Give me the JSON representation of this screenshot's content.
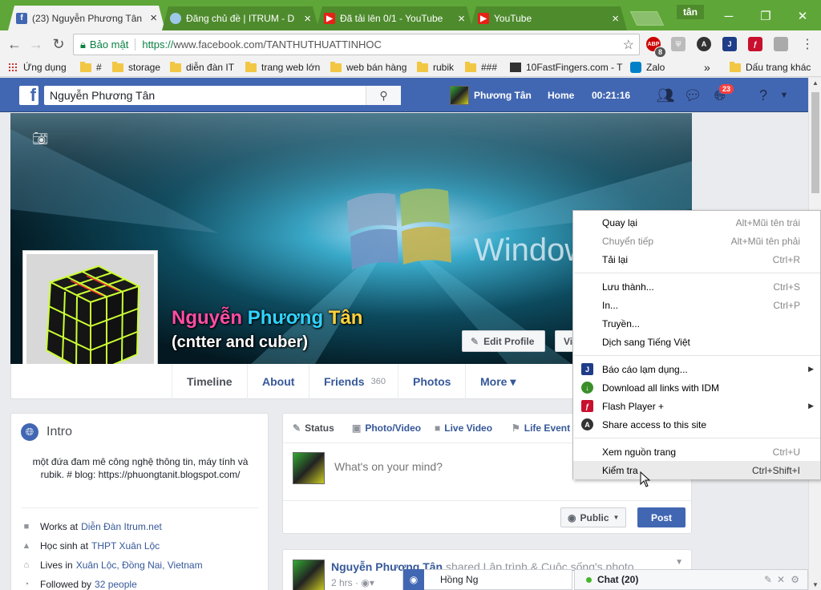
{
  "browser": {
    "tabs": [
      {
        "title": "(23) Nguyễn Phương Tân",
        "icon": "facebook-icon",
        "active": true
      },
      {
        "title": "Đăng chủ đề | ITRUM - D",
        "icon": "cloud-icon",
        "active": false
      },
      {
        "title": "Đã tải lên 0/1 - YouTube",
        "icon": "youtube-icon",
        "active": false
      },
      {
        "title": "YouTube",
        "icon": "youtube-icon",
        "active": false
      }
    ],
    "profile_name": "tân",
    "security_label": "Bảo mật",
    "url_scheme": "https://",
    "url_rest": "www.facebook.com/TANTHUTHUATTINHOC",
    "ext_badge": "8",
    "bookmarks": [
      {
        "label": "Ứng dụng",
        "icon": "apps-grid-icon"
      },
      {
        "label": "#",
        "icon": "folder-icon"
      },
      {
        "label": "storage",
        "icon": "folder-icon"
      },
      {
        "label": "diễn đàn IT",
        "icon": "folder-icon"
      },
      {
        "label": "trang web lớn",
        "icon": "folder-icon"
      },
      {
        "label": "web bán hàng",
        "icon": "folder-icon"
      },
      {
        "label": "rubik",
        "icon": "folder-icon"
      },
      {
        "label": "###",
        "icon": "folder-icon"
      },
      {
        "label": "10FastFingers.com - T",
        "icon": "keyboard-icon"
      },
      {
        "label": "Zalo",
        "icon": "zalo-icon"
      },
      {
        "label": "Dấu trang khác",
        "icon": "folder-icon"
      }
    ],
    "bookmarks_more": "»"
  },
  "fb": {
    "search_value": "Nguyễn Phương Tân",
    "nav_user": "Phương Tân",
    "nav_home": "Home",
    "nav_time": "00:21:16",
    "notif_count": "23"
  },
  "profile": {
    "name_parts": [
      "Nguyễn ",
      "Phương ",
      "Tân"
    ],
    "name_colors": [
      "#ff4da6",
      "#2fd4ff",
      "#ffd23c"
    ],
    "subtitle": "(cntter and cuber)",
    "edit_profile": "Edit Profile",
    "view_btn": "Vi",
    "cover_text": "Window",
    "tabs": [
      {
        "label": "Timeline",
        "active": true
      },
      {
        "label": "About",
        "active": false
      },
      {
        "label": "Friends",
        "count": "360",
        "active": false
      },
      {
        "label": "Photos",
        "active": false
      },
      {
        "label": "More ▾",
        "active": false
      }
    ]
  },
  "intro": {
    "title": "Intro",
    "bio": "một đứa đam mê công nghệ thông tin, máy tính và rubik. # blog: https://phuongtanit.blogspot.com/",
    "rows": [
      {
        "prefix": "Works at",
        "link": "Diễn Đàn Itrum.net",
        "icon": "briefcase-icon"
      },
      {
        "prefix": "Học sinh at",
        "link": "THPT Xuân Lộc",
        "icon": "school-icon"
      },
      {
        "prefix": "Lives in",
        "link": "Xuân Lộc, Đồng Nai, Vietnam",
        "icon": "home-icon"
      },
      {
        "prefix": "Followed by",
        "link": "32 people",
        "icon": "rss-icon"
      }
    ]
  },
  "composer": {
    "tabs": [
      {
        "label": "Status",
        "icon": "pencil-icon"
      },
      {
        "label": "Photo/Video",
        "icon": "camera-icon"
      },
      {
        "label": "Live Video",
        "icon": "video-icon"
      },
      {
        "label": "Life Event",
        "icon": "flag-icon"
      }
    ],
    "placeholder": "What's on your mind?",
    "audience": "Public",
    "post": "Post"
  },
  "story": {
    "author": "Nguyễn Phương Tân",
    "action": "shared Lập trình & Cuộc sống's photo.",
    "time": "2 hrs"
  },
  "context_menu": {
    "items": [
      {
        "label": "Quay lại",
        "shortcut": "Alt+Mũi tên trái",
        "disabled": false
      },
      {
        "label": "Chuyển tiếp",
        "shortcut": "Alt+Mũi tên phải",
        "disabled": true
      },
      {
        "label": "Tải lại",
        "shortcut": "Ctrl+R",
        "disabled": false
      },
      {
        "label": "Lưu thành...",
        "shortcut": "Ctrl+S",
        "disabled": false
      },
      {
        "label": "In...",
        "shortcut": "Ctrl+P",
        "disabled": false
      },
      {
        "label": "Truyền...",
        "shortcut": "",
        "disabled": false
      },
      {
        "label": "Dịch sang Tiếng Việt",
        "shortcut": "",
        "disabled": false
      },
      {
        "label": "Báo cáo lạm dụng...",
        "shortcut": "",
        "icon": "j-extension-icon",
        "submenu": true
      },
      {
        "label": "Download all links with IDM",
        "shortcut": "",
        "icon": "idm-icon"
      },
      {
        "label": "Flash Player +",
        "shortcut": "",
        "icon": "flash-icon",
        "submenu": true
      },
      {
        "label": "Share access to this site",
        "shortcut": "",
        "icon": "share-a-icon"
      },
      {
        "label": "Xem nguồn trang",
        "shortcut": "Ctrl+U",
        "disabled": false
      },
      {
        "label": "Kiểm tra",
        "shortcut": "Ctrl+Shift+I",
        "disabled": false,
        "highlighted": true
      }
    ]
  },
  "chat": {
    "label": "Chat (20)",
    "mini_name": "Hồng Ng"
  },
  "colors": {
    "tab_strip": "#5fa638",
    "fb_blue": "#4267b2",
    "link": "#365899"
  }
}
